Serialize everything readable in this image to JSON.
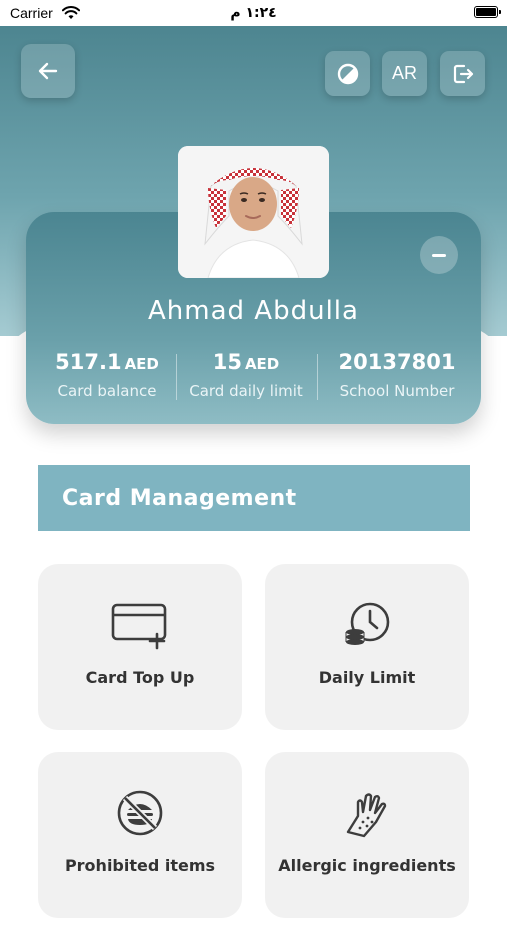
{
  "status_bar": {
    "carrier": "Carrier",
    "time": "١:٢٤ م"
  },
  "header": {
    "language_toggle": "AR",
    "icons": [
      "back-arrow-icon",
      "contrast-icon",
      "logout-icon"
    ]
  },
  "profile": {
    "name": "Ahmad Abdulla",
    "stats": [
      {
        "value": "517.1",
        "unit": "AED",
        "label": "Card balance"
      },
      {
        "value": "15",
        "unit": "AED",
        "label": "Card daily limit"
      },
      {
        "value": "20137801",
        "unit": "",
        "label": "School Number"
      }
    ]
  },
  "section": {
    "title": "Card Management"
  },
  "tiles": [
    {
      "label": "Card Top Up",
      "icon": "card-top-up-icon"
    },
    {
      "label": "Daily Limit",
      "icon": "daily-limit-icon"
    },
    {
      "label": "Prohibited items",
      "icon": "prohibited-items-icon"
    },
    {
      "label": "Allergic ingredients",
      "icon": "allergic-glove-icon"
    }
  ],
  "colors": {
    "header_gradient_top": "#4d8590",
    "header_gradient_bottom": "#a5cbd2",
    "section_header": "#7fb4c1",
    "tile_background": "#f1f1f1",
    "tile_text": "#333333"
  }
}
